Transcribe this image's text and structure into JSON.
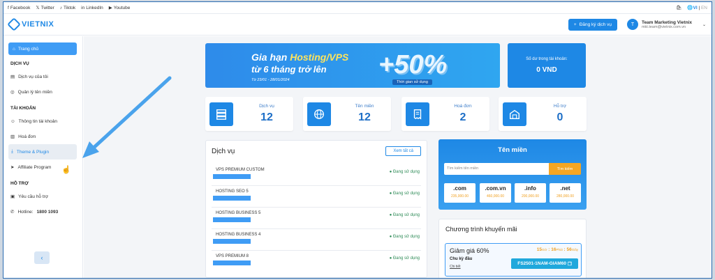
{
  "topbar": {
    "social": [
      "Facebook",
      "Twitter",
      "Tiktok",
      "LinkedIn",
      "Youtube"
    ],
    "lang_active": "VI",
    "lang_other": "EN"
  },
  "header": {
    "brand": "VIETNIX",
    "register_label": "Đăng ký dịch vụ",
    "user_initial": "T",
    "user_name": "Team Marketing Vietnix",
    "user_email": "mkt.team@vietnix.com.vn"
  },
  "sidebar": {
    "home": "Trang chủ",
    "sec_service": "DỊCH VỤ",
    "my_services": "Dịch vụ của tôi",
    "domain_manage": "Quản lý tên miền",
    "sec_account": "TÀI KHOẢN",
    "account_info": "Thông tin tài khoản",
    "invoices": "Hoá đơn",
    "theme_plugin": "Theme & Plugin",
    "affiliate": "Affiliate Program",
    "sec_support": "HỖ TRỢ",
    "support_request": "Yêu cầu hỗ trợ",
    "hotline_label": "Hotline:",
    "hotline_number": "1800 1093"
  },
  "banner": {
    "line1_a": "Gia hạn ",
    "line1_b": "Hosting/VPS",
    "line2": "từ 6 tháng trở lên",
    "date": "Từ 23/01 - 28/01/2024",
    "plus": "+50%",
    "tag": "Thời gian sử dụng"
  },
  "balance": {
    "title": "Số dư trong tài khoản:",
    "value": "0 VND"
  },
  "stats": [
    {
      "label": "Dịch vụ",
      "value": "12"
    },
    {
      "label": "Tên miền",
      "value": "12"
    },
    {
      "label": "Hoá đơn",
      "value": "2"
    },
    {
      "label": "Hỗ trợ",
      "value": "0"
    }
  ],
  "services": {
    "title": "Dịch vụ",
    "view_all": "Xem tất cả",
    "rows": [
      {
        "name": "VPS PREMIUM CUSTOM",
        "status": "Đang sử dụng"
      },
      {
        "name": "HOSTING SEO 5",
        "status": "Đang sử dụng"
      },
      {
        "name": "HOSTING BUSINESS 5",
        "status": "Đang sử dụng"
      },
      {
        "name": "HOSTING BUSINESS 4",
        "status": "Đang sử dụng"
      },
      {
        "name": "VPS PREMIUM 8",
        "status": "Đang sử dụng"
      }
    ]
  },
  "domain": {
    "title": "Tên miền",
    "placeholder": "Tìm kiếm tên miền",
    "search_btn": "Tìm kiếm",
    "tlds": [
      {
        "ext": ".com",
        "price": "235,000.00"
      },
      {
        "ext": ".com.vn",
        "price": "460,000.00"
      },
      {
        "ext": ".info",
        "price": "200,000.00"
      },
      {
        "ext": ".net",
        "price": "280,000.00"
      }
    ]
  },
  "promo": {
    "title": "Chương trình khuyến mãi",
    "discount": "Giảm giá 60%",
    "cycle": "Chu kỳ đầu",
    "detail": "Chi tiết",
    "hours": "15",
    "hours_unit": "Giờ",
    "minutes": "16",
    "minutes_unit": "Phút",
    "seconds": "56",
    "seconds_unit": "Giây",
    "code": "FS2501-1NAM-GIAM60"
  },
  "colors": {
    "accent": "#1e88e5",
    "status_green": "#2e8b57",
    "price_orange": "#f0a020"
  }
}
